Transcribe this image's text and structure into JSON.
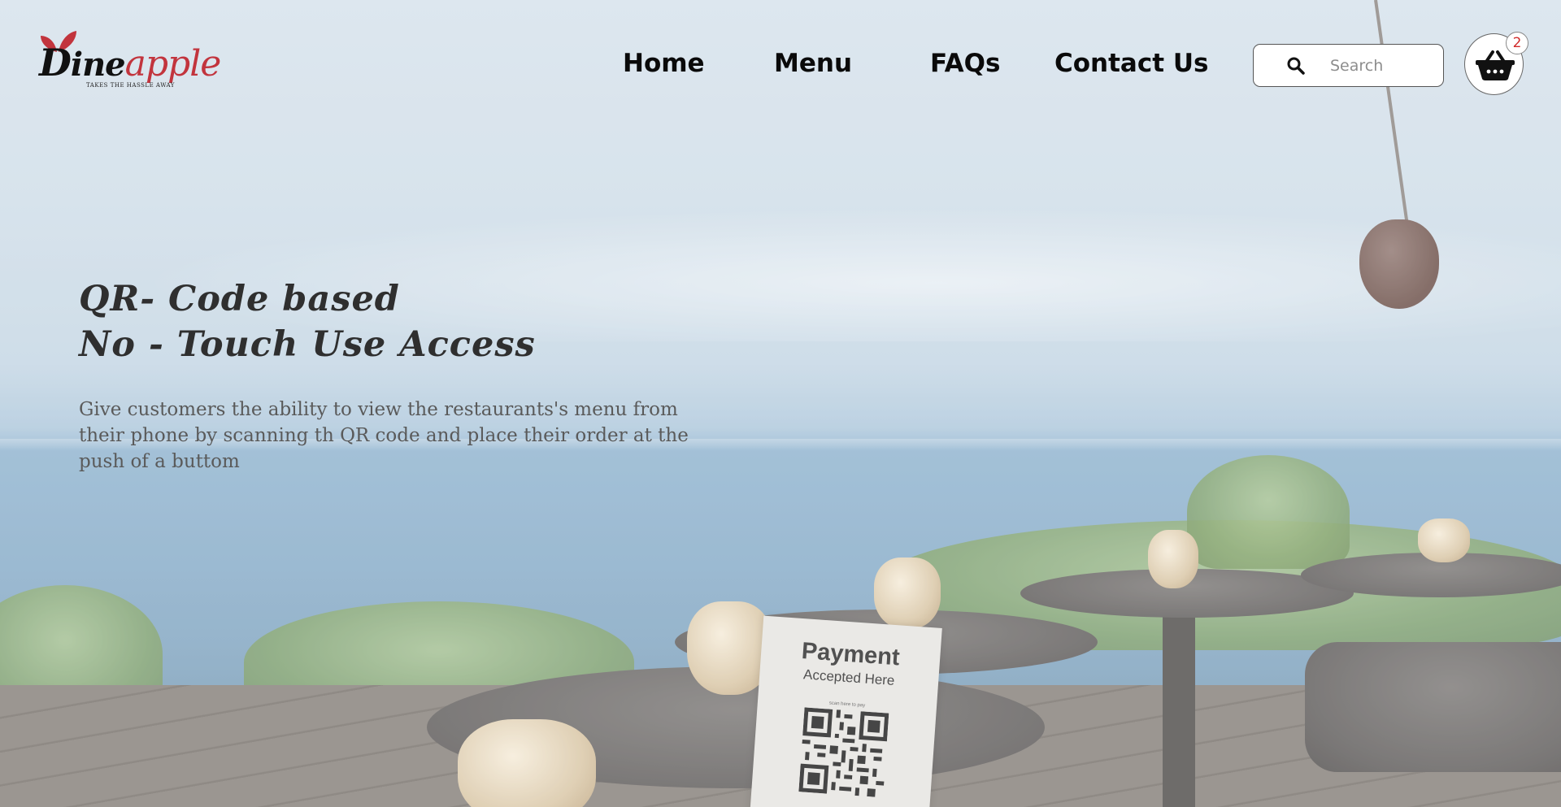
{
  "brand": {
    "name_part1": "D",
    "name_part2": "ine",
    "name_part3": "apple",
    "tagline": "TAKES THE HASSLE AWAY",
    "colors": {
      "primary_text": "#111111",
      "accent": "#c2343d"
    }
  },
  "nav": {
    "items": [
      {
        "label": "Home"
      },
      {
        "label": "Menu"
      },
      {
        "label": "FAQs"
      },
      {
        "label": "Contact Us"
      }
    ]
  },
  "search": {
    "placeholder": "Search",
    "value": "",
    "icon": "search-icon"
  },
  "cart": {
    "icon": "basket-icon",
    "count": "2",
    "badge_color": "#d12b2b"
  },
  "hero": {
    "title_line1": "QR- Code based",
    "title_line2": "No - Touch Use Access",
    "description": "Give customers the ability to view the restaurants's menu from their phone by scanning th QR code and place their order at the push of a buttom"
  },
  "qr_stand": {
    "title": "Payment",
    "subtitle": "Accepted Here",
    "small_text": "scan here to pay"
  }
}
